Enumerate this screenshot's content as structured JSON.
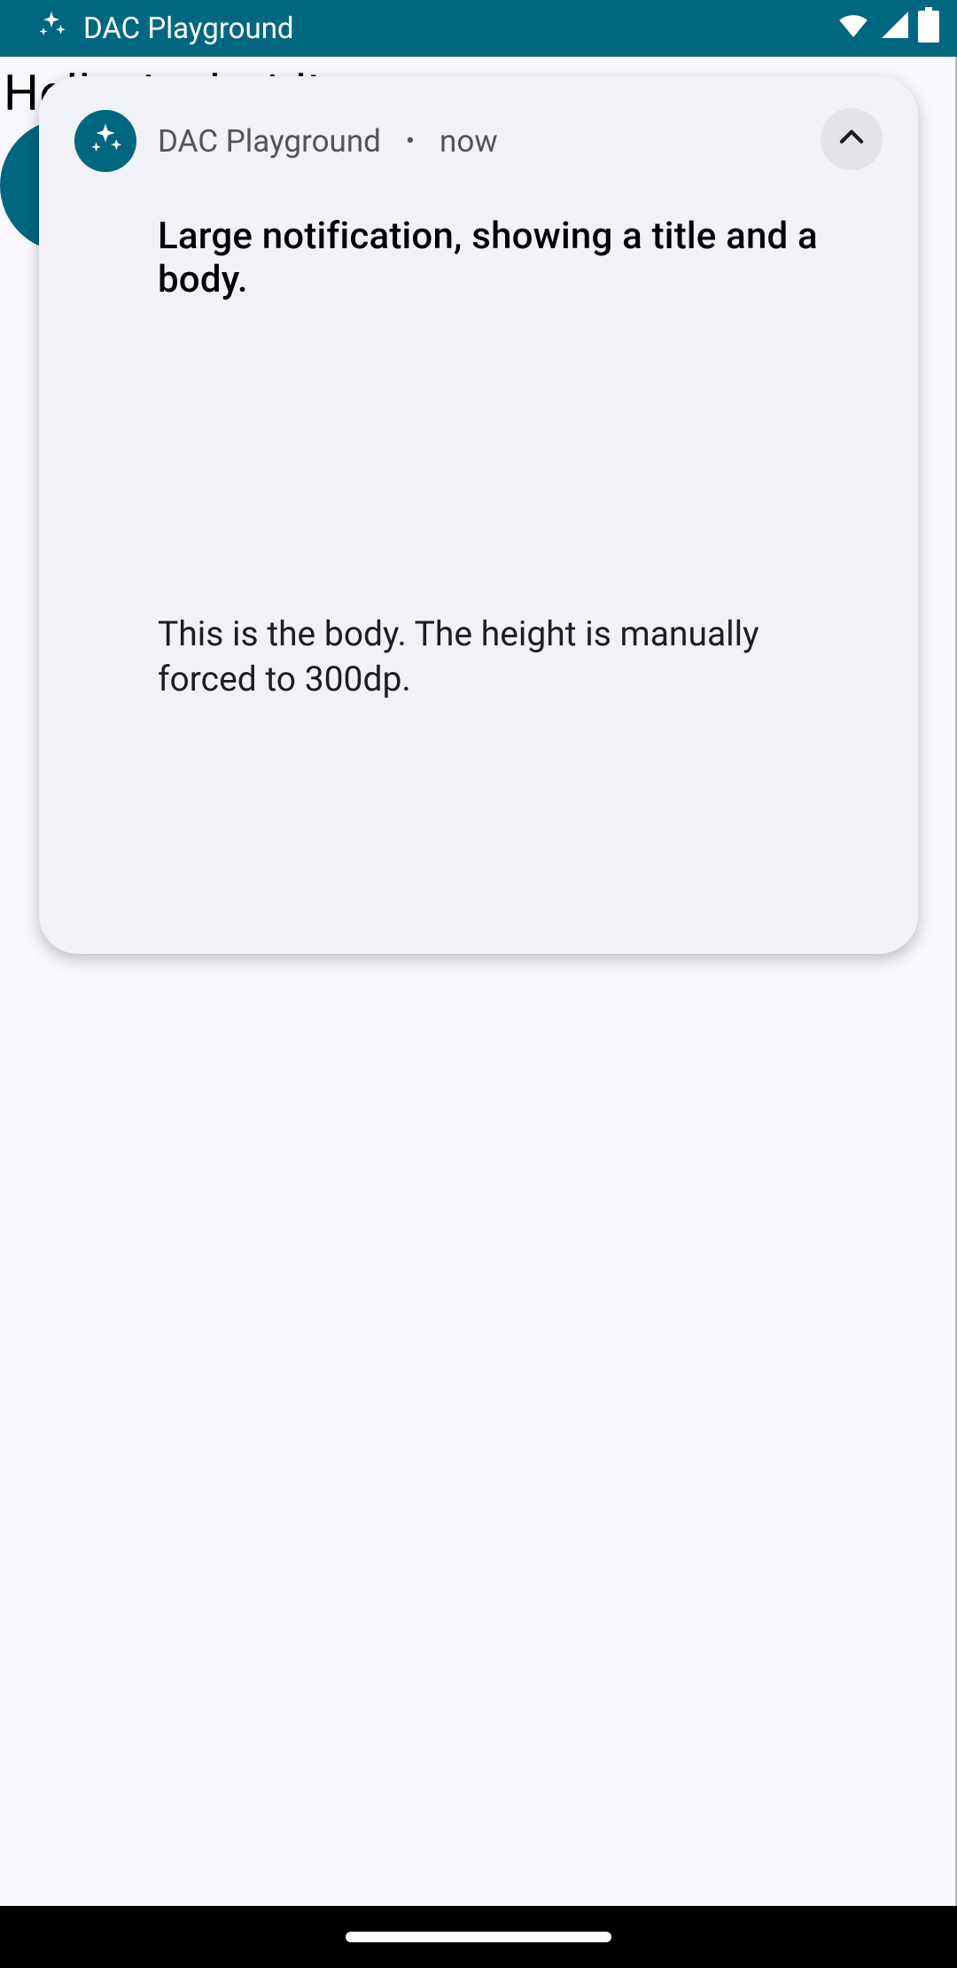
{
  "status_bar": {
    "app_name": "DAC Playground",
    "icons": {
      "status_app": "sparkle-icon",
      "wifi": "wifi-icon",
      "cell": "cell-signal-icon",
      "battery": "battery-icon"
    }
  },
  "background": {
    "title": "Hello Android!"
  },
  "notification": {
    "app_icon": "sparkle-icon",
    "app_name": "DAC Playground",
    "time": "now",
    "separator": "•",
    "title": "Large notification, showing a title and a body.",
    "body": "This is the body. The height is manually forced to 300dp.",
    "collapse_icon": "chevron-up-icon"
  }
}
